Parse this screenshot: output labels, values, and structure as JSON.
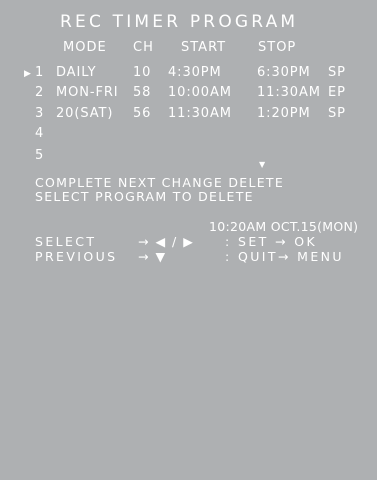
{
  "title": "REC TIMER PROGRAM",
  "columns": {
    "mode": "MODE",
    "ch": "CH",
    "start": "START",
    "stop": "STOP"
  },
  "cursor": "▶",
  "programs": [
    {
      "num": "1",
      "mode": "DAILY",
      "ch": "10",
      "start": "4:30PM",
      "stop": "6:30PM",
      "speed": "SP"
    },
    {
      "num": "2",
      "mode": "MON-FRI",
      "ch": "58",
      "start": "10:00AM",
      "stop": "11:30AM",
      "speed": "EP"
    },
    {
      "num": "3",
      "mode": "20(SAT)",
      "ch": "56",
      "start": "11:30AM",
      "stop": "1:20PM",
      "speed": "SP"
    },
    {
      "num": "4",
      "mode": "",
      "ch": "",
      "start": "",
      "stop": "",
      "speed": ""
    },
    {
      "num": "5",
      "mode": "",
      "ch": "",
      "start": "",
      "stop": "",
      "speed": ""
    }
  ],
  "scroll_indicator": "▼",
  "message": {
    "line1": "COMPLETE NEXT CHANGE DELETE",
    "line2": "SELECT PROGRAM TO DELETE"
  },
  "clock": "10:20AM OCT.15(MON)",
  "help": {
    "select_label": "SELECT",
    "select_keys": "→ ◀ / ▶",
    "set": ": SET → OK",
    "previous_label": "PREVIOUS",
    "previous_keys": "→ ▼",
    "quit": ": QUIT→ MENU"
  }
}
